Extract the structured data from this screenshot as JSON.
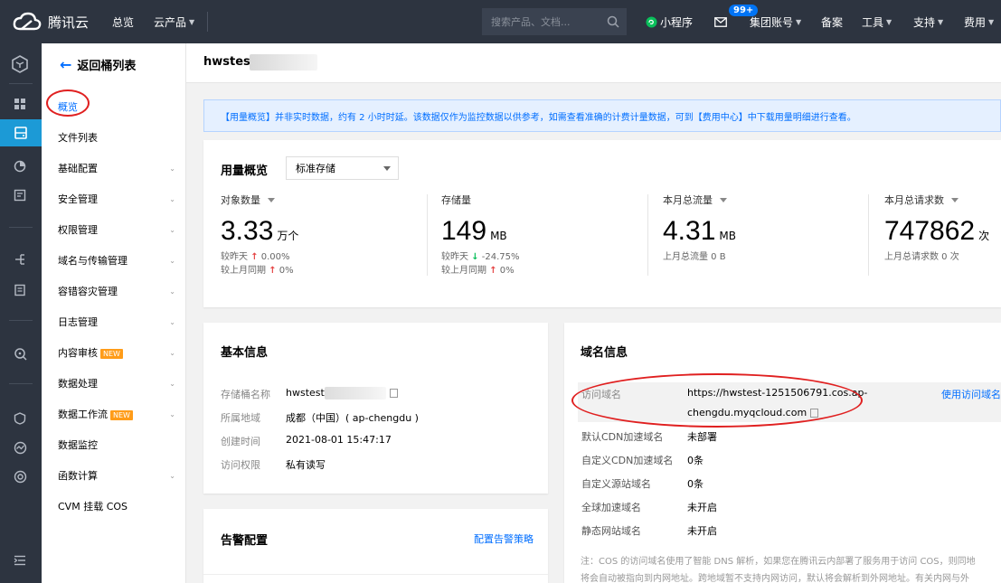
{
  "topbar": {
    "brand": "腾讯云",
    "nav_overview": "总览",
    "nav_products": "云产品",
    "search_placeholder": "搜索产品、文档...",
    "mini_program": "小程序",
    "message_badge": "99+",
    "group_account": "集团账号",
    "filing": "备案",
    "tools": "工具",
    "support": "支持",
    "billing": "费用"
  },
  "sidebar": {
    "back_label": "返回桶列表",
    "new_tag": "NEW",
    "items": [
      {
        "label": "概览",
        "expand": false
      },
      {
        "label": "文件列表",
        "expand": false
      },
      {
        "label": "基础配置",
        "expand": true
      },
      {
        "label": "安全管理",
        "expand": true
      },
      {
        "label": "权限管理",
        "expand": true
      },
      {
        "label": "域名与传输管理",
        "expand": true
      },
      {
        "label": "容错容灾管理",
        "expand": true
      },
      {
        "label": "日志管理",
        "expand": true
      },
      {
        "label": "内容审核",
        "expand": true
      },
      {
        "label": "数据处理",
        "expand": true
      },
      {
        "label": "数据工作流",
        "expand": true
      },
      {
        "label": "数据监控",
        "expand": false
      },
      {
        "label": "函数计算",
        "expand": true
      },
      {
        "label": "CVM 挂载 COS",
        "expand": false
      }
    ]
  },
  "header": {
    "bucket_name": "hwstest"
  },
  "notice": "【用量概览】并非实时数据，约有 2 小时时延。该数据仅作为监控数据以供参考，如需查看准确的计费计量数据，可到【费用中心】中下载用量明细进行查看。",
  "usage": {
    "title": "用量概览",
    "storage_class": "标准存储",
    "metrics": [
      {
        "label": "对象数量",
        "value": "3.33",
        "unit": "万个",
        "sub1_label": "较昨天",
        "sub1_value": "0.00%",
        "sub2_label": "较上月同期",
        "sub2_value": "0%"
      },
      {
        "label": "存储量",
        "value": "149",
        "unit": "MB",
        "sub1_label": "较昨天",
        "sub1_value": "-24.75%",
        "sub2_label": "较上月同期",
        "sub2_value": "0%"
      },
      {
        "label": "本月总流量",
        "value": "4.31",
        "unit": "MB",
        "sub1_label": "上月总流量 0 B"
      },
      {
        "label": "本月总请求数",
        "value": "747862",
        "unit": "次",
        "sub1_label": "上月总请求数 0 次"
      }
    ]
  },
  "basic_info": {
    "title": "基本信息",
    "rows": [
      {
        "key": "存储桶名称",
        "value": "hwstest"
      },
      {
        "key": "所属地域",
        "value": "成都（中国）( ap-chengdu )"
      },
      {
        "key": "创建时间",
        "value": "2021-08-01 15:47:17"
      },
      {
        "key": "访问权限",
        "value": "私有读写"
      }
    ]
  },
  "alarm": {
    "title": "告警配置",
    "link": "配置告警策略"
  },
  "domain_info": {
    "title": "域名信息",
    "access_domain_key": "访问域名",
    "access_domain_line1": "https://hwstest-1251506791.cos.ap-",
    "access_domain_line2": "chengdu.myqcloud.com",
    "use_link": "使用访问域名:",
    "rows": [
      {
        "key": "默认CDN加速域名",
        "value": "未部署"
      },
      {
        "key": "自定义CDN加速域名",
        "value": "0条"
      },
      {
        "key": "自定义源站域名",
        "value": "0条"
      },
      {
        "key": "全球加速域名",
        "value": "未开启"
      },
      {
        "key": "静态网站域名",
        "value": "未开启"
      }
    ],
    "note_line1": "注：COS 的访问域名使用了智能 DNS 解析，如果您在腾讯云内部署了服务用于访问 COS，则同地",
    "note_line2": "将会自动被指向到内网地址。跨地域暂不支持内网访问，默认将会解析到外网地址。有关内网与外"
  }
}
